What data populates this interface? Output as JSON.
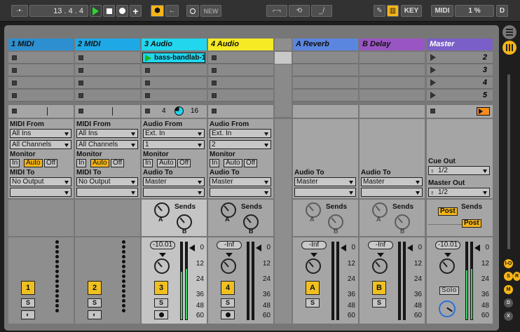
{
  "transport": {
    "position": "13 .  4 .  4",
    "new_label": "NEW",
    "key_label": "KEY",
    "midi_label": "MIDI",
    "cpu": "1 %",
    "d_label": "D"
  },
  "tracks": [
    {
      "name": "1 MIDI",
      "color": "#2d8fcf",
      "type": "midi",
      "input_label": "MIDI From",
      "input": "All Ins",
      "channel": "All Channels",
      "monitor_label": "Monitor",
      "mon": [
        "In",
        "Auto",
        "Off"
      ],
      "output_label": "MIDI To",
      "output": "No Output",
      "number": "1"
    },
    {
      "name": "2 MIDI",
      "color": "#1fa8e6",
      "type": "midi",
      "input_label": "MIDI From",
      "input": "All Ins",
      "channel": "All Channels",
      "monitor_label": "Monitor",
      "mon": [
        "In",
        "Auto",
        "Off"
      ],
      "output_label": "MIDI To",
      "output": "No Output",
      "number": "2"
    },
    {
      "name": "3 Audio",
      "color": "#22d6ee",
      "type": "audio",
      "clip": "bass-bandlab-1",
      "warp_a": "4",
      "warp_b": "16",
      "input_label": "Audio From",
      "input": "Ext. In",
      "channel": "1",
      "monitor_label": "Monitor",
      "mon": [
        "In",
        "Auto",
        "Off"
      ],
      "output_label": "Audio To",
      "output": "Master",
      "sends_label": "Sends",
      "send_a": "A",
      "send_b": "B",
      "volume": "-10.01",
      "number": "3"
    },
    {
      "name": "4 Audio",
      "color": "#f5ea24",
      "type": "audio",
      "input_label": "Audio From",
      "input": "Ext. In",
      "channel": "2",
      "monitor_label": "Monitor",
      "mon": [
        "In",
        "Auto",
        "Off"
      ],
      "output_label": "Audio To",
      "output": "Master",
      "sends_label": "Sends",
      "send_a": "A",
      "send_b": "B",
      "volume": "-Inf",
      "number": "4"
    }
  ],
  "returns": [
    {
      "name": "A Reverb",
      "color": "#5b86e0",
      "output_label": "Audio To",
      "output": "Master",
      "sends_label": "Sends",
      "send_a": "A",
      "send_b": "B",
      "volume": "-Inf",
      "letter": "A"
    },
    {
      "name": "B Delay",
      "color": "#9a55c4",
      "output_label": "Audio To",
      "output": "Master",
      "sends_label": "Sends",
      "send_a": "A",
      "send_b": "B",
      "volume": "-Inf",
      "letter": "B"
    }
  ],
  "master": {
    "name": "Master",
    "color": "#7a5fc8",
    "scenes": [
      "2",
      "3",
      "4",
      "5"
    ],
    "cue_label": "Cue Out",
    "cue": "1/2",
    "out_label": "Master Out",
    "out": "1/2",
    "sends_label": "Sends",
    "post": "Post",
    "volume": "-10.01",
    "solo": "Solo"
  },
  "solo_label": "S",
  "meter_scale": [
    "0",
    "12",
    "24",
    "36",
    "48",
    "60"
  ],
  "right_panel": [
    "I-O",
    "S",
    "R",
    "M",
    "D",
    "X"
  ],
  "colors": {
    "yellow": "#f0c020",
    "orange": "#f5b519"
  }
}
